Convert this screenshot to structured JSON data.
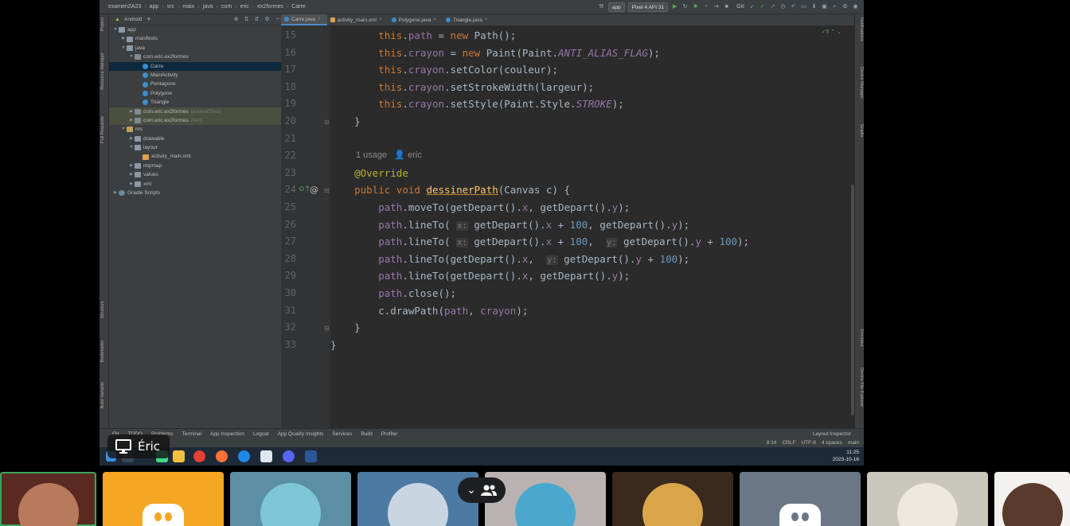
{
  "ide": {
    "breadcrumbs": [
      "examen2A23",
      "app",
      "src",
      "main",
      "java",
      "com",
      "eric",
      "ex2formes",
      "Carre"
    ],
    "toolbar": {
      "run_config": "app",
      "device": "Pixel 4 API 31",
      "git_label": "Git:"
    },
    "project_view": "Android",
    "tree": [
      {
        "label": "app",
        "depth": 0,
        "icon": "folder",
        "expanded": true
      },
      {
        "label": "manifests",
        "depth": 1,
        "icon": "folder",
        "expanded": false
      },
      {
        "label": "java",
        "depth": 1,
        "icon": "folder",
        "expanded": true
      },
      {
        "label": "com.eric.ex2formes",
        "depth": 2,
        "icon": "package",
        "expanded": true
      },
      {
        "label": "Carre",
        "depth": 3,
        "icon": "class",
        "selected": true
      },
      {
        "label": "MainActivity",
        "depth": 3,
        "icon": "class"
      },
      {
        "label": "Pentagone",
        "depth": 3,
        "icon": "class"
      },
      {
        "label": "Polygone",
        "depth": 3,
        "icon": "class"
      },
      {
        "label": "Triangle",
        "depth": 3,
        "icon": "class"
      },
      {
        "label": "com.eric.ex2formes",
        "suffix": "(androidTest)",
        "depth": 2,
        "icon": "package",
        "expanded": false,
        "test": true
      },
      {
        "label": "com.eric.ex2formes",
        "suffix": "(test)",
        "depth": 2,
        "icon": "package",
        "expanded": false,
        "test": true
      },
      {
        "label": "res",
        "depth": 1,
        "icon": "res",
        "expanded": true
      },
      {
        "label": "drawable",
        "depth": 2,
        "icon": "folder",
        "expanded": false
      },
      {
        "label": "layout",
        "depth": 2,
        "icon": "folder",
        "expanded": true
      },
      {
        "label": "activity_main.xml",
        "depth": 3,
        "icon": "xml"
      },
      {
        "label": "mipmap",
        "depth": 2,
        "icon": "folder",
        "expanded": false
      },
      {
        "label": "values",
        "depth": 2,
        "icon": "folder",
        "expanded": false
      },
      {
        "label": "xml",
        "depth": 2,
        "icon": "folder",
        "expanded": false
      },
      {
        "label": "Gradle Scripts",
        "depth": 0,
        "icon": "gradle",
        "expanded": false
      }
    ],
    "editor_tabs": [
      {
        "label": "Carre.java",
        "active": true,
        "icon": "class"
      },
      {
        "label": "activity_main.xml",
        "active": false,
        "icon": "xml"
      },
      {
        "label": "Polygone.java",
        "active": false,
        "icon": "class"
      },
      {
        "label": "Triangle.java",
        "active": false,
        "icon": "class"
      }
    ],
    "line_numbers": [
      "15",
      "16",
      "17",
      "18",
      "19",
      "20",
      "21",
      "22",
      "23",
      "24",
      "25",
      "26",
      "27",
      "28",
      "29",
      "30",
      "31",
      "32",
      "33"
    ],
    "inlay": {
      "usages": "1 usage",
      "author": "eric"
    },
    "warnings_badge": "5",
    "left_stripe": [
      "Project",
      "Resource Manager",
      "Pull Requests",
      "Structure",
      "Bookmarks",
      "Build Variants"
    ],
    "right_stripe": [
      "Notifications",
      "Device Manager",
      "Gradle",
      "Emulator",
      "Device File Explorer"
    ],
    "tool_tabs": [
      "Git",
      "TODO",
      "Problems",
      "Terminal",
      "App Inspection",
      "Logcat",
      "App Quality Insights",
      "Services",
      "Build",
      "Profiler"
    ],
    "layout_inspector": "Layout Inspector",
    "status": [
      "8:14",
      "CRLF",
      "UTF-8",
      "4 spaces",
      "main"
    ],
    "clock": {
      "time": "11:25",
      "date": "2023-10-16"
    }
  },
  "presenter": {
    "name": "Éric"
  },
  "participants": [
    {
      "type": "photo",
      "bg": "#5a2a22",
      "face": "#b77a5c",
      "speaking": true
    },
    {
      "type": "discord",
      "bg": "#f5a623"
    },
    {
      "type": "avatar",
      "bg": "#5b8fa3",
      "face": "#7cc6d6"
    },
    {
      "type": "avatar",
      "bg": "#4d7aa3",
      "face": "#c9d6e2"
    },
    {
      "type": "avatar",
      "bg": "#b9b2b0",
      "face": "#4aa8cf"
    },
    {
      "type": "avatar",
      "bg": "#3a2a1e",
      "face": "#d9a54b"
    },
    {
      "type": "discord",
      "bg": "#6b7787"
    },
    {
      "type": "avatar",
      "bg": "#c9c6bd",
      "face": "#ece8df"
    },
    {
      "type": "avatar",
      "bg": "#f4f2ee",
      "face": "#5a3a2a"
    }
  ]
}
